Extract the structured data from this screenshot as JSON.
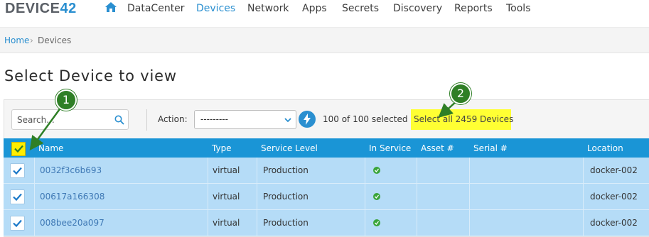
{
  "app": {
    "logo_text": "DEVICE",
    "logo_number": "42"
  },
  "nav": {
    "home_icon": "home-icon",
    "items": [
      {
        "label": "DataCenter",
        "active": false
      },
      {
        "label": "Devices",
        "active": true
      },
      {
        "label": "Network",
        "active": false
      },
      {
        "label": "Apps",
        "active": false
      },
      {
        "label": "Secrets",
        "active": false
      },
      {
        "label": "Discovery",
        "active": false
      },
      {
        "label": "Reports",
        "active": false
      },
      {
        "label": "Tools",
        "active": false
      }
    ]
  },
  "breadcrumb": {
    "home": "Home",
    "separator": "›",
    "current": "Devices"
  },
  "page": {
    "title": "Select Device to view"
  },
  "toolbar": {
    "search_placeholder": "Search...",
    "action_label": "Action:",
    "action_value": "---------",
    "selected_text": "100 of 100 selected",
    "select_all_text": "Select all 2459 Devices"
  },
  "table": {
    "columns": [
      "Name",
      "Type",
      "Service Level",
      "In Service",
      "Asset #",
      "Serial #",
      "Location"
    ],
    "rows": [
      {
        "name": "0032f3c6b693",
        "type": "virtual",
        "service_level": "Production",
        "in_service": true,
        "asset": "",
        "serial": "",
        "location": "docker-002",
        "checked": true
      },
      {
        "name": "00617a166308",
        "type": "virtual",
        "service_level": "Production",
        "in_service": true,
        "asset": "",
        "serial": "",
        "location": "docker-002",
        "checked": true
      },
      {
        "name": "008bee20a097",
        "type": "virtual",
        "service_level": "Production",
        "in_service": true,
        "asset": "",
        "serial": "",
        "location": "docker-002",
        "checked": true
      }
    ]
  },
  "annotations": [
    {
      "label": "1"
    },
    {
      "label": "2"
    }
  ],
  "colors": {
    "accent": "#2a8fd0",
    "header_blue": "#1a95d6",
    "row_selected": "#b5dcf7",
    "highlight": "#ffff33",
    "marker_green": "#2f7f26"
  }
}
